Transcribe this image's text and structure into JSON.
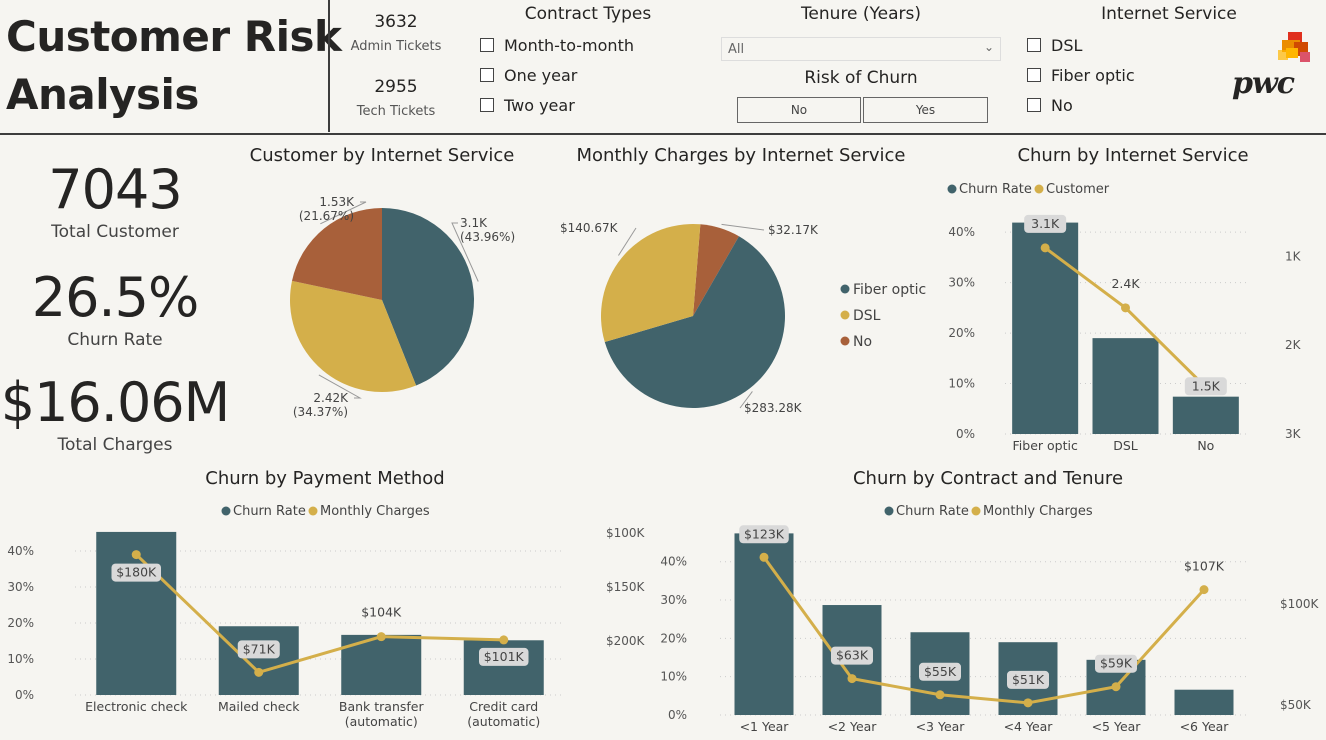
{
  "header": {
    "title_line1": "Customer Risk",
    "title_line2": "Analysis",
    "admin_tickets_value": "3632",
    "admin_tickets_label": "Admin Tickets",
    "tech_tickets_value": "2955",
    "tech_tickets_label": "Tech Tickets",
    "logo_text": "pwc"
  },
  "slicers": {
    "contract": {
      "title": "Contract Types",
      "options": [
        "Month-to-month",
        "One year",
        "Two year"
      ]
    },
    "tenure": {
      "title": "Tenure (Years)",
      "selected": "All"
    },
    "risk": {
      "title": "Risk of Churn",
      "options": [
        "No",
        "Yes"
      ]
    },
    "internet": {
      "title": "Internet Service",
      "options": [
        "DSL",
        "Fiber optic",
        "No"
      ]
    }
  },
  "kpis": {
    "customers_value": "7043",
    "customers_label": "Total Customer",
    "churn_value": "26.5%",
    "churn_label": "Churn Rate",
    "charges_value": "$16.06M",
    "charges_label": "Total Charges"
  },
  "colors": {
    "teal": "#41636b",
    "gold": "#d4af4a",
    "rust": "#a8603a"
  },
  "chart_data": [
    {
      "id": "customer_by_internet",
      "type": "pie",
      "title": "Customer by Internet Service",
      "categories": [
        "Fiber optic",
        "DSL",
        "No"
      ],
      "values": [
        3096,
        2421,
        1526
      ],
      "labels": [
        "3.1K",
        "2.42K",
        "1.53K"
      ],
      "percents": [
        "(43.96%)",
        "(34.37%)",
        "(21.67%)"
      ]
    },
    {
      "id": "monthly_charges_by_internet",
      "type": "pie",
      "title": "Monthly Charges by Internet Service",
      "categories": [
        "Fiber optic",
        "DSL",
        "No"
      ],
      "values": [
        283.28,
        140.67,
        32.17
      ],
      "labels": [
        "$283.28K",
        "$140.67K",
        "$32.17K"
      ],
      "legend": [
        "Fiber optic",
        "DSL",
        "No"
      ]
    },
    {
      "id": "churn_by_internet",
      "type": "bar",
      "title": "Churn by Internet Service",
      "legend": [
        "Churn Rate",
        "Customer"
      ],
      "categories": [
        "Fiber optic",
        "DSL",
        "No"
      ],
      "bar_values": [
        41.9,
        19.0,
        7.4
      ],
      "line_values": [
        3096,
        2421,
        1526
      ],
      "line_labels": [
        "3.1K",
        "2.4K",
        "1.5K"
      ],
      "y_ticks": [
        "0%",
        "10%",
        "20%",
        "30%",
        "40%"
      ],
      "y2_ticks": [
        "1K",
        "2K",
        "3K"
      ],
      "ylim": [
        0,
        44
      ],
      "y2lim": [
        1000,
        3500
      ]
    },
    {
      "id": "churn_by_payment",
      "type": "bar",
      "title": "Churn by Payment Method",
      "legend": [
        "Churn Rate",
        "Monthly Charges"
      ],
      "categories": [
        "Electronic check",
        "Mailed check",
        "Bank transfer\n(automatic)",
        "Credit card\n(automatic)"
      ],
      "bar_values": [
        45.3,
        19.1,
        16.7,
        15.2
      ],
      "line_values": [
        180,
        71,
        104,
        101
      ],
      "line_labels": [
        "$180K",
        "$71K",
        "$104K",
        "$101K"
      ],
      "y_ticks": [
        "0%",
        "10%",
        "20%",
        "30%",
        "40%"
      ],
      "y2_ticks": [
        "$100K",
        "$150K",
        "$200K"
      ],
      "ylim": [
        0,
        45
      ],
      "y2lim": [
        50,
        200
      ]
    },
    {
      "id": "churn_by_contract_tenure",
      "type": "bar",
      "title": "Churn by Contract and Tenure",
      "legend": [
        "Churn Rate",
        "Monthly Charges"
      ],
      "categories": [
        "<1 Year",
        "<2 Year",
        "<3 Year",
        "<4 Year",
        "<5 Year",
        "<6 Year"
      ],
      "bar_values": [
        47.4,
        28.7,
        21.6,
        19.0,
        14.4,
        6.6
      ],
      "line_values": [
        123,
        63,
        55,
        51,
        59,
        107
      ],
      "line_labels": [
        "$123K",
        "$63K",
        "$55K",
        "$51K",
        "$59K",
        "$107K"
      ],
      "y_ticks": [
        "0%",
        "10%",
        "20%",
        "30%",
        "40%"
      ],
      "y2_ticks": [
        "$50K",
        "$100K"
      ],
      "ylim": [
        0,
        47.5
      ],
      "y2lim": [
        45,
        135
      ]
    }
  ]
}
